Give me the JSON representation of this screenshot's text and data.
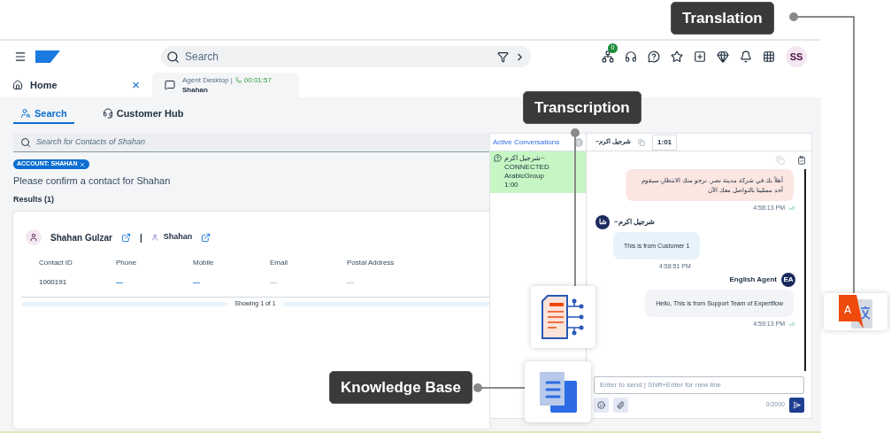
{
  "header": {
    "search_placeholder": "Search",
    "status_badge": "0",
    "avatar": "SS"
  },
  "tabs": [
    {
      "label": "Home",
      "selected": false,
      "close": "×"
    },
    {
      "label": "Agent Desktop |",
      "timer": "00:01:57",
      "subtitle": "Shahan",
      "selected": true
    }
  ],
  "page_tabs": [
    {
      "label": "Search",
      "selected": true
    },
    {
      "label": "Customer Hub",
      "selected": false
    }
  ],
  "contact_search": {
    "placeholder": "Search for Contacts of Shahan"
  },
  "filter_chip": "ACCOUNT: SHAHAN",
  "prompt": "Please confirm a contact for Shahan",
  "results_label": "Results (1)",
  "contact": {
    "name": "Shahan Gulzar",
    "separator": "|",
    "account": "Shahan",
    "fields": [
      {
        "label": "Contact ID",
        "value": "1000191",
        "kind": "text"
      },
      {
        "label": "Phone",
        "value": "—",
        "kind": "link"
      },
      {
        "label": "Mobile",
        "value": "—",
        "kind": "link"
      },
      {
        "label": "Email",
        "value": "—",
        "kind": "empty"
      },
      {
        "label": "Postal Address",
        "value": "—",
        "kind": "empty"
      }
    ],
    "pagination": "Showing 1 of 1"
  },
  "conversations": {
    "title": "Active Conversations",
    "items": [
      {
        "name": "شرجيل اكرم~",
        "status": "CONNECTED",
        "queue": "ArabicGroup",
        "time": "1:00",
        "selected": true
      }
    ]
  },
  "chat": {
    "contact": "~شرجيل اكرم",
    "timer": "1:01",
    "messages": [
      {
        "kind": "outgoing",
        "text": "أهلاً بك في شركة مدينة نصر. نرجو منك الانتظار، سيقوم أحد ممثلينا بالتواصل معك الآن",
        "time": "4:58:13 PM",
        "color": "#fce6e2"
      },
      {
        "kind": "incoming",
        "sender": "~شرجيل اكرم",
        "avatar": "شا",
        "text": "This is from Customer 1",
        "time": "4:58:51 PM",
        "color": "#e7f3fb"
      },
      {
        "kind": "outgoing",
        "sender": "English Agent",
        "avatar": "EA",
        "text": "Hello, This is from Support Team of Expertflow",
        "time": "4:59:13 PM",
        "color": "#f3f4f7"
      }
    ],
    "input_placeholder": "Enter to send | Shift+Enter for new line",
    "counter": "0/2000"
  },
  "callouts": [
    {
      "label": "Translation",
      "kind": "translation",
      "icon_letter": "A"
    },
    {
      "label": "Transcription",
      "kind": "transcription"
    },
    {
      "label": "Knowledge Base",
      "kind": "knowledge"
    }
  ]
}
